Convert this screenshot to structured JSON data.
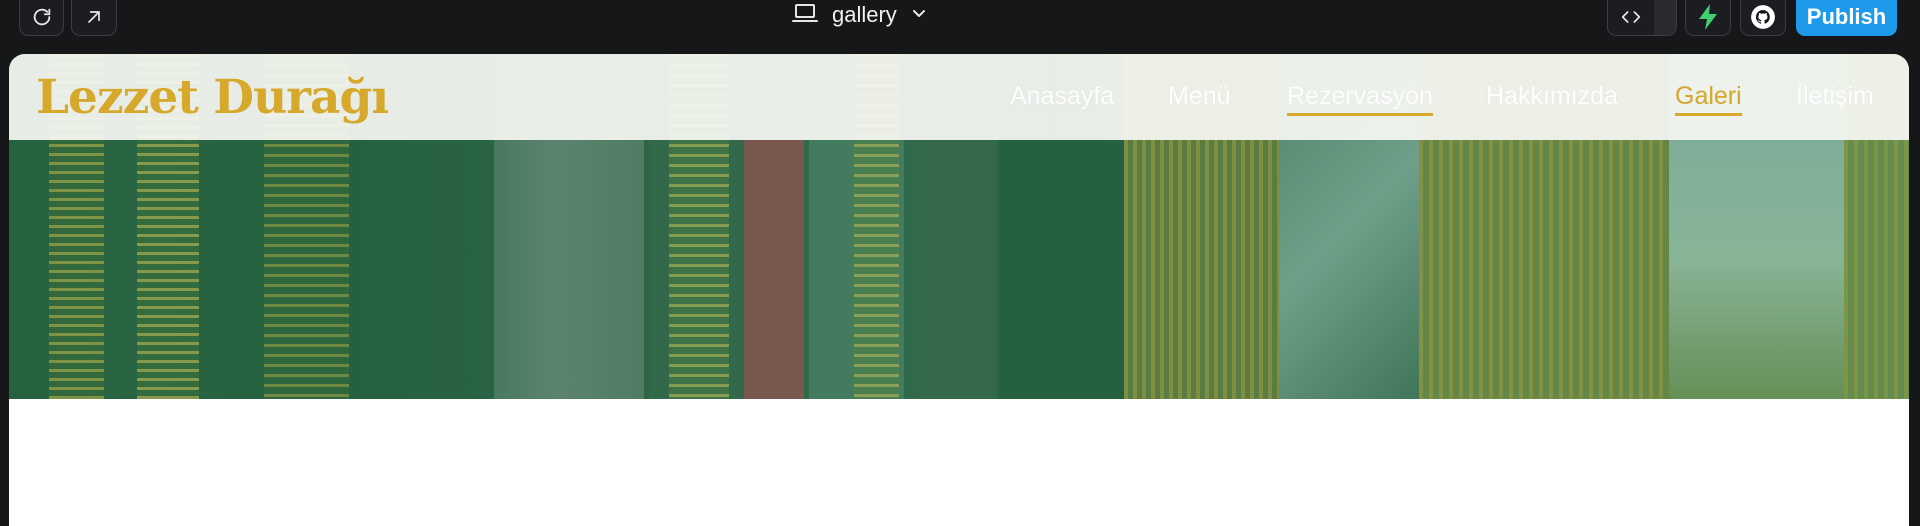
{
  "toolbar": {
    "refresh_icon": "refresh-icon",
    "open_external_icon": "arrow-up-right-icon",
    "device_icon": "laptop-icon",
    "page_selector_label": "gallery",
    "code_icon": "code-icon",
    "bolt_icon": "lightning-bolt-icon",
    "github_icon": "github-icon",
    "publish_label": "Publish",
    "publish_color": "#1d9bea",
    "bolt_color": "#3ecf6e"
  },
  "site": {
    "logo_text": "Lezzet Durağı",
    "brand_color": "#d6a82c",
    "nav": [
      {
        "label": "Anasayfa",
        "underlined": false,
        "active": false
      },
      {
        "label": "Menü",
        "underlined": false,
        "active": false
      },
      {
        "label": "Rezervasyon",
        "underlined": true,
        "active": false
      },
      {
        "label": "Hakkımızda",
        "underlined": false,
        "active": false
      },
      {
        "label": "Galeri",
        "underlined": true,
        "active": true
      },
      {
        "label": "İletişim",
        "underlined": false,
        "active": false
      }
    ]
  }
}
